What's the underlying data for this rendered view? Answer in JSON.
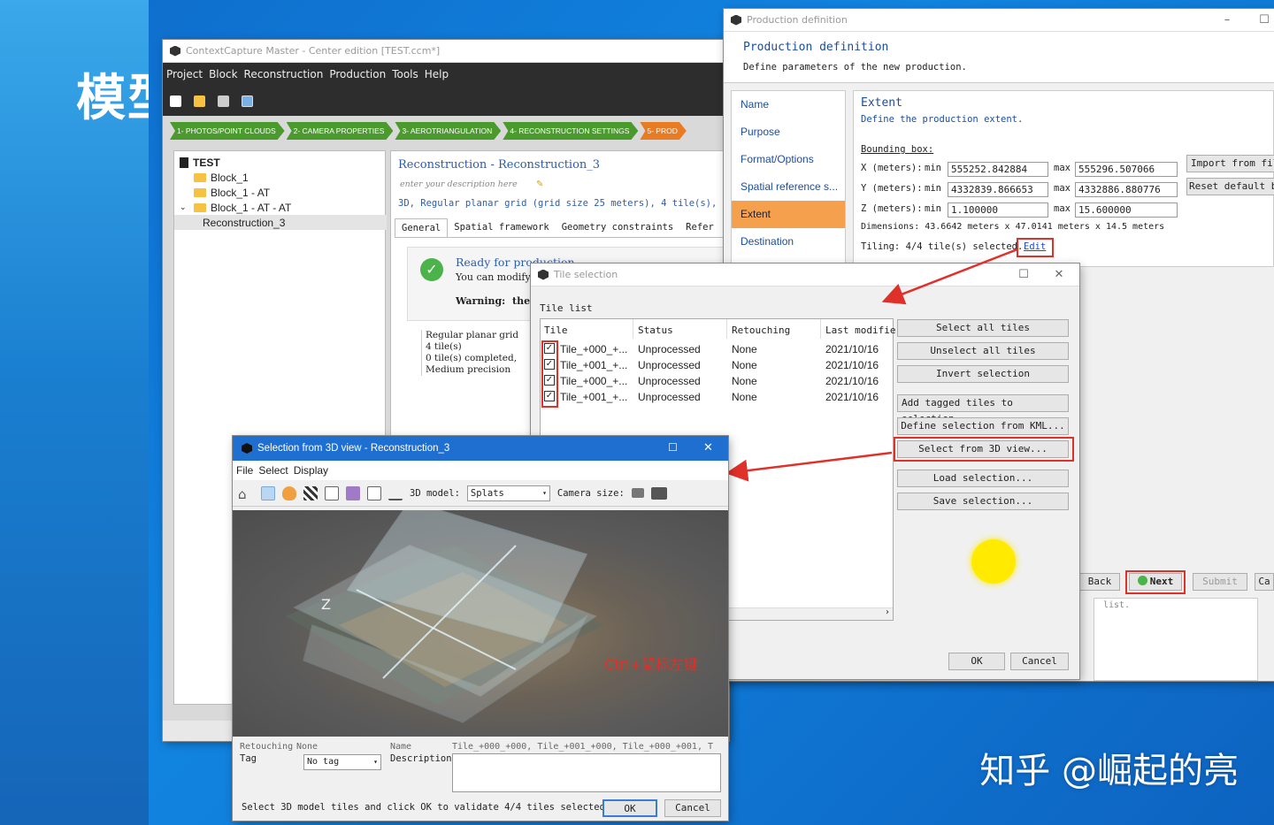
{
  "slide": {
    "title": "模型",
    "watermark": "知乎 @崛起的亮"
  },
  "app": {
    "title": "ContextCapture Master - Center edition [TEST.ccm*]",
    "menu": [
      "Project",
      "Block",
      "Reconstruction",
      "Production",
      "Tools",
      "Help"
    ],
    "steps": [
      "1- PHOTOS/POINT CLOUDS",
      "2- CAMERA PROPERTIES",
      "3- AEROTRIANGULATION",
      "4- RECONSTRUCTION SETTINGS",
      "5- PROD"
    ],
    "tree": {
      "root": "TEST",
      "items": [
        "Block_1",
        "Block_1 - AT",
        "Block_1 - AT - AT",
        "Reconstruction_3"
      ]
    },
    "detail": {
      "heading": "Reconstruction - Reconstruction_3",
      "description_placeholder": "enter your description here",
      "summary": "3D, Regular planar grid (grid size 25 meters), 4 tile(s), m",
      "tabs": [
        "General",
        "Spatial framework",
        "Geometry constraints",
        "Refer"
      ],
      "ready_title": "Ready for production",
      "ready_text": "You can modify",
      "warning_label": "Warning:",
      "warning_text": "the",
      "info_lines": [
        "Regular planar grid",
        "4 tile(s)",
        "0 tile(s) completed,",
        "Medium precision"
      ]
    }
  },
  "production": {
    "window_title": "Production definition",
    "heading": "Production definition",
    "subheading": "Define parameters of the new production.",
    "nav": [
      "Name",
      "Purpose",
      "Format/Options",
      "Spatial reference s...",
      "Extent",
      "Destination"
    ],
    "nav_selected": "Extent",
    "extent_title": "Extent",
    "extent_sub": "Define the production extent.",
    "bbox_label": "Bounding box:",
    "rows": [
      {
        "label": "X (meters):",
        "min": "555252.842884",
        "max": "555296.507066"
      },
      {
        "label": "Y (meters):",
        "min": "4332839.866653",
        "max": "4332886.880776"
      },
      {
        "label": "Z (meters):",
        "min": "1.100000",
        "max": "15.600000"
      }
    ],
    "min_label": "min",
    "max_label": "max",
    "dimensions": "Dimensions: 43.6642 meters x 47.0141 meters x 14.5 meters",
    "tiling": "Tiling: 4/4 tile(s) selected.",
    "edit_link": "Edit",
    "import_btn": "Import from fil",
    "reset_btn": "Reset default bo",
    "back_btn": "Back",
    "next_btn": "Next",
    "submit_btn": "Submit",
    "cancel_btn": "Ca",
    "list_fragment": "list."
  },
  "tile_selection": {
    "window_title": "Tile selection",
    "list_label": "Tile list",
    "columns": [
      "Tile",
      "Status",
      "Retouching",
      "Last modifie"
    ],
    "rows": [
      {
        "tile": "Tile_+000_+...",
        "status": "Unprocessed",
        "retouching": "None",
        "modified": "2021/10/16"
      },
      {
        "tile": "Tile_+001_+...",
        "status": "Unprocessed",
        "retouching": "None",
        "modified": "2021/10/16"
      },
      {
        "tile": "Tile_+000_+...",
        "status": "Unprocessed",
        "retouching": "None",
        "modified": "2021/10/16"
      },
      {
        "tile": "Tile_+001_+...",
        "status": "Unprocessed",
        "retouching": "None",
        "modified": "2021/10/16"
      }
    ],
    "buttons": {
      "select_all": "Select all tiles",
      "unselect_all": "Unselect all tiles",
      "invert": "Invert selection",
      "add_tagged": "Add tagged tiles to selection",
      "define_kml": "Define selection from KML...",
      "select_3d": "Select from 3D view...",
      "load": "Load selection...",
      "save": "Save selection...",
      "ok": "OK",
      "cancel": "Cancel"
    }
  },
  "view3d": {
    "window_title": "Selection from 3D view - Reconstruction_3",
    "menu": [
      "File",
      "Select",
      "Display"
    ],
    "model_label": "3D model:",
    "model_value": "Splats",
    "camera_label": "Camera size:",
    "axis_label": "Z",
    "annotation": "Ctrl+鼠标左键",
    "retouching_label": "Retouching",
    "retouching_value": "None",
    "tag_label": "Tag",
    "tag_value": "No tag",
    "name_label": "Name",
    "name_value": "Tile_+000_+000, Tile_+001_+000, Tile_+000_+001, T",
    "description_label": "Description",
    "status": "Select 3D model tiles and click OK to validate 4/4 tiles selected",
    "ok": "OK",
    "cancel": "Cancel"
  },
  "colors": {
    "accent_red": "#e0302a",
    "step_green": "#4a9a2e",
    "step_orange": "#e87c24",
    "nav_selected": "#f5a04c"
  }
}
